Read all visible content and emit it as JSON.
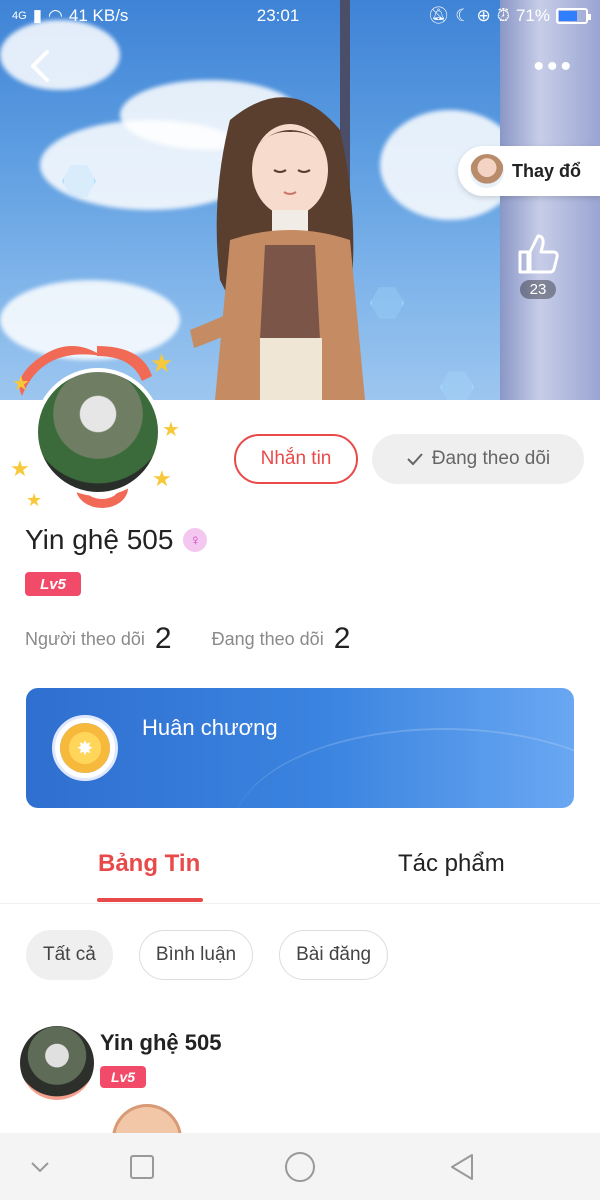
{
  "status_bar": {
    "network": "4G",
    "speed": "41 KB/s",
    "time": "23:01",
    "battery_percent": "71%",
    "battery_level": 0.71
  },
  "header": {
    "change_label": "Thay đổ",
    "like_count": "23"
  },
  "profile": {
    "name": "Yin ghệ 505",
    "level": "Lv5",
    "followers_label": "Người theo dõi",
    "followers_count": "2",
    "following_label": "Đang theo dõi",
    "following_count": "2"
  },
  "actions": {
    "message_label": "Nhắn tin",
    "following_label": "Đang theo dõi"
  },
  "medal": {
    "label": "Huân chương"
  },
  "tabs": [
    {
      "label": "Bảng Tin",
      "active": true
    },
    {
      "label": "Tác phẩm",
      "active": false
    }
  ],
  "filters": [
    {
      "label": "Tất cả",
      "active": true
    },
    {
      "label": "Bình luận",
      "active": false
    },
    {
      "label": "Bài đăng",
      "active": false
    }
  ],
  "post": {
    "author": "Yin ghệ 505",
    "level": "Lv5"
  },
  "colors": {
    "accent": "#e84a4a",
    "level_badge": "#f24b6a",
    "medal_card": "#3b84e0"
  }
}
